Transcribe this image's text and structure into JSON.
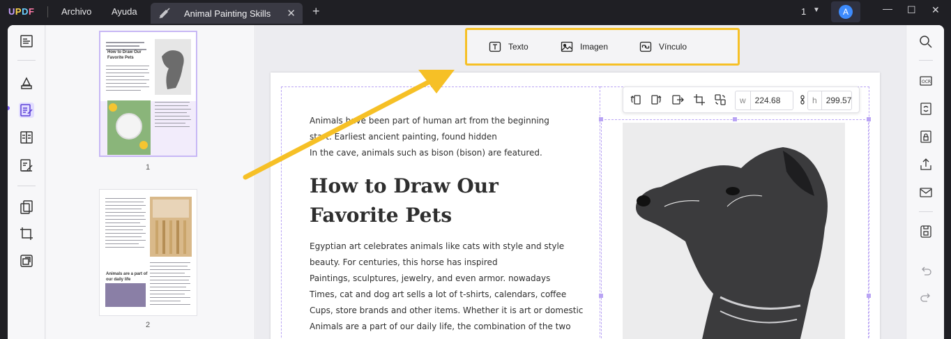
{
  "app": {
    "logo_letters": [
      "U",
      "P",
      "D",
      "F"
    ],
    "menu": [
      "Archivo",
      "Ayuda"
    ],
    "tab_title": "Animal Painting Skills",
    "page_indicator": "1",
    "avatar_letter": "A"
  },
  "insert_toolbar": {
    "text_label": "Texto",
    "image_label": "Imagen",
    "link_label": "Vínculo",
    "highlight_color": "#f6c026"
  },
  "image_toolbar": {
    "width_label": "w",
    "width_value": "224.68",
    "height_label": "h",
    "height_value": "299.57"
  },
  "thumbnails": [
    {
      "page_number": "1",
      "heading": "How to Draw Our Favorite Pets"
    },
    {
      "page_number": "2",
      "heading": "Animals are a part of our daily life"
    }
  ],
  "document": {
    "intro_lines": [
      "Animals have been part of human art from the beginning",
      "start. Earliest ancient painting, found hidden",
      "In the cave, animals such as bison (bison) are featured."
    ],
    "heading_lines": [
      "How to Draw Our",
      "Favorite Pets"
    ],
    "body_lines": [
      "Egyptian art celebrates animals like cats with style and style",
      "beauty. For centuries, this horse has inspired",
      "Paintings, sculptures, jewelry, and even armor. nowadays",
      "Times, cat and dog art sells a lot of t-shirts, calendars, coffee",
      "Cups, store brands and other items. Whether it is art or domestic",
      "Animals are a part of our daily life, the combination of the two"
    ]
  },
  "colors": {
    "accent": "#7b5cf5",
    "selection": "#b9a4f4",
    "arrow": "#f6c026"
  }
}
